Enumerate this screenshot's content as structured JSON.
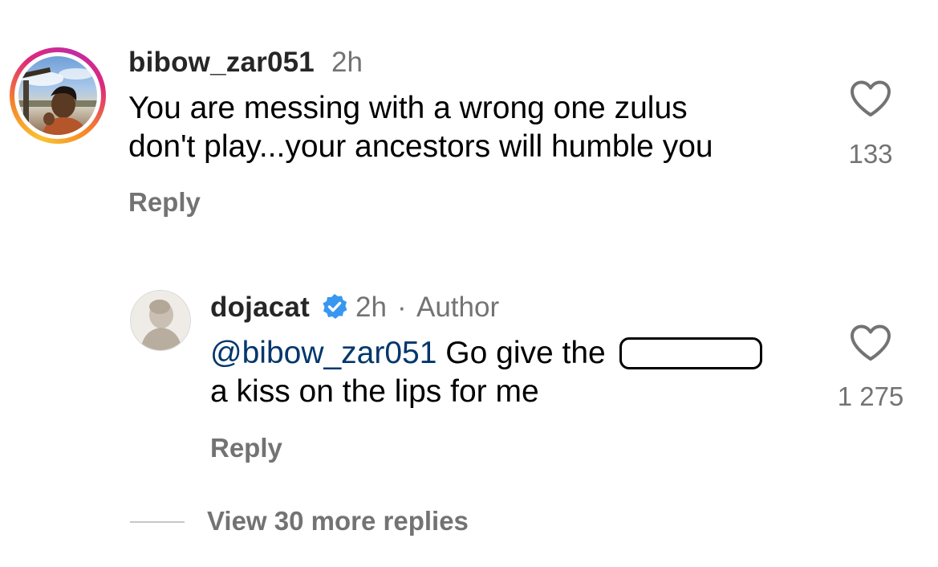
{
  "comment": {
    "username": "bibow_zar051",
    "time": "2h",
    "text_line1": "You are messing with a wrong one zulus",
    "text_line2": "don't play...your ancestors will humble you",
    "reply_label": "Reply",
    "like_count": "133",
    "like_icon": "heart-outline-icon",
    "avatar_ring_colors": [
      "#f9c430",
      "#f58529",
      "#dd2a7b",
      "#c32aa3"
    ]
  },
  "reply": {
    "username": "dojacat",
    "verified_icon": "verified-badge-icon",
    "verified_color": "#3897f0",
    "time": "2h",
    "separator": "·",
    "author_label": "Author",
    "mention": "@bibow_zar051",
    "text_line1_after_mention": "Go give the",
    "text_line2": "a kiss on the lips for me",
    "reply_label": "Reply",
    "like_count": "1 275",
    "like_icon": "heart-outline-icon"
  },
  "thread": {
    "view_more_label": "View 30 more replies"
  },
  "colors": {
    "text_primary": "#000000",
    "text_secondary": "#737373",
    "mention": "#00376b"
  }
}
